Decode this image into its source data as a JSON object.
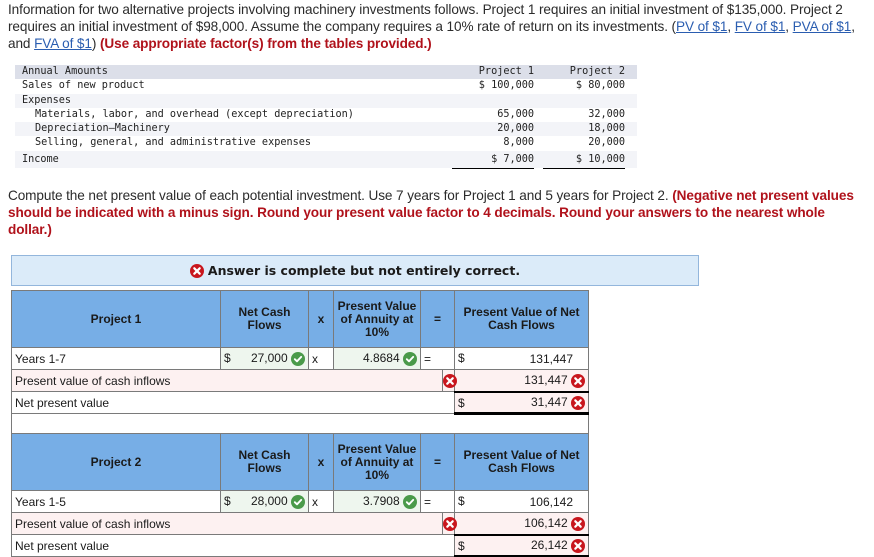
{
  "intro": {
    "text_1": "Information for two alternative projects involving machinery investments follows. Project 1 requires an initial investment of $135,000. Project 2 requires an initial investment of $98,000. Assume the company requires a 10% rate of return on its investments. (",
    "links": [
      "PV of $1",
      "FV of $1",
      "PVA of $1",
      "FVA of $1"
    ],
    "sep_1": ", ",
    "sep_2": ", ",
    "sep_3": ", and ",
    "close": ") ",
    "emphasis": "(Use appropriate factor(s) from the tables provided.)"
  },
  "reference_table": {
    "header": {
      "label": "Annual Amounts",
      "project_1": "Project 1",
      "project_2": "Project 2"
    },
    "rows": [
      {
        "label": "Sales of new product",
        "project_1": "$ 100,000",
        "project_2": "$ 80,000"
      },
      {
        "label": "Expenses",
        "project_1": "",
        "project_2": ""
      },
      {
        "label": "Materials, labor, and overhead (except depreciation)",
        "project_1": "65,000",
        "project_2": "32,000"
      },
      {
        "label": "Depreciation—Machinery",
        "project_1": "20,000",
        "project_2": "18,000"
      },
      {
        "label": "Selling, general, and administrative expenses",
        "project_1": "8,000",
        "project_2": "20,000"
      },
      {
        "label": "Income",
        "project_1": "$ 7,000",
        "project_2": "$ 10,000"
      }
    ]
  },
  "instructions": {
    "text": "Compute the net present value of each potential investment. Use 7 years for Project 1 and 5 years for Project 2. ",
    "emphasis": "(Negative net present values should be indicated with a minus sign. Round your present value factor to 4 decimals. Round your answers to the nearest whole dollar.)"
  },
  "banner": {
    "icon": "x-circle-icon",
    "text": "Answer is complete but not entirely correct."
  },
  "colors": {
    "header_blue": "#77aee6",
    "banner_bg": "#dbebf9",
    "correct_green": "#4a9a4a",
    "incorrect_red": "#c8161d",
    "error_pink": "#fdf1f1"
  },
  "calc_headers": {
    "net_cash_flows": "Net Cash Flows",
    "times": "x",
    "pv_annuity": "Present Value of Annuity at 10%",
    "equals": "=",
    "pv_net_cash_flows": "Present Value of Net Cash Flows"
  },
  "projects": [
    {
      "title": "Project 1",
      "years_label": "Years 1-7",
      "currency": "$",
      "net_cash_flow": "27,000",
      "net_cash_flow_status": "correct",
      "times": "x",
      "pv_factor": "4.8684",
      "pv_factor_status": "correct",
      "equals": "=",
      "pv_result": "131,447",
      "pv_inflows_label": "Present value of cash inflows",
      "pv_inflows_value": "131,447",
      "pv_inflows_status": "incorrect",
      "npv_label": "Net present value",
      "npv_value": "31,447",
      "npv_status": "incorrect"
    },
    {
      "title": "Project 2",
      "years_label": "Years 1-5",
      "currency": "$",
      "net_cash_flow": "28,000",
      "net_cash_flow_status": "correct",
      "times": "x",
      "pv_factor": "3.7908",
      "pv_factor_status": "correct",
      "equals": "=",
      "pv_result": "106,142",
      "pv_inflows_label": "Present value of cash inflows",
      "pv_inflows_value": "106,142",
      "pv_inflows_status": "incorrect",
      "npv_label": "Net present value",
      "npv_value": "26,142",
      "npv_status": "incorrect"
    }
  ]
}
